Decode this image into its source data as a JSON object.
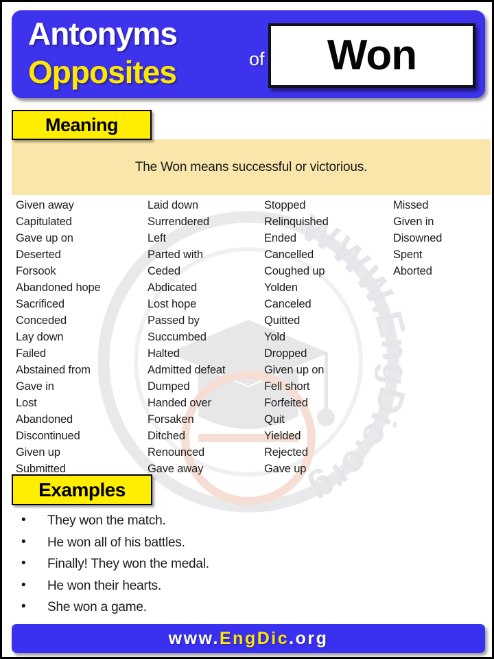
{
  "header": {
    "title_line1": "Antonyms",
    "title_line2": "Opposites",
    "connector": "of",
    "word": "Won",
    "bg_color": "#3d33ec",
    "title_line1_color": "#ffffff",
    "title_line2_color": "#ffe800"
  },
  "meaning": {
    "label": "Meaning",
    "text": "The Won means successful or victorious.",
    "tag_color": "#ffee00",
    "band_color": "#fae6ab"
  },
  "words": {
    "columns": [
      [
        "Given away",
        "Capitulated",
        "Gave up on",
        "Deserted",
        "Forsook",
        "Abandoned hope",
        "Sacrificed",
        "Conceded",
        "Lay down",
        "Failed",
        "Abstained from",
        "Gave in",
        "Lost",
        "Abandoned",
        "Discontinued",
        "Given up",
        "Submitted"
      ],
      [
        "Laid down",
        "Surrendered",
        "Left",
        "Parted with",
        "Ceded",
        "Abdicated",
        "Lost hope",
        "Passed by",
        "Succumbed",
        "Halted",
        "Admitted defeat",
        "Dumped",
        "Handed over",
        "Forsaken",
        "Ditched",
        "Renounced",
        "Gave away"
      ],
      [
        "Stopped",
        "Relinquished",
        "Ended",
        "Cancelled",
        "Coughed up",
        "Yolden",
        "Canceled",
        "Quitted",
        "Yold",
        "Dropped",
        "Given up on",
        "Fell short",
        "Forfeited",
        "Quit",
        "Yielded",
        "Rejected",
        "Gave up"
      ],
      [
        "Missed",
        "Given in",
        "Disowned",
        "Spent",
        "Aborted"
      ]
    ]
  },
  "examples": {
    "label": "Examples",
    "items": [
      "They won the match.",
      "He won all of his battles.",
      "Finally! They won the medal.",
      "He won their hearts.",
      "She won a game."
    ]
  },
  "footer": {
    "text_white_1": "www.",
    "text_yellow_1": "EngDic",
    "text_white_2": ".org",
    "bg_color": "#3a30f0"
  },
  "watermark": {
    "ring_text": "WWW.EngDic.org"
  }
}
